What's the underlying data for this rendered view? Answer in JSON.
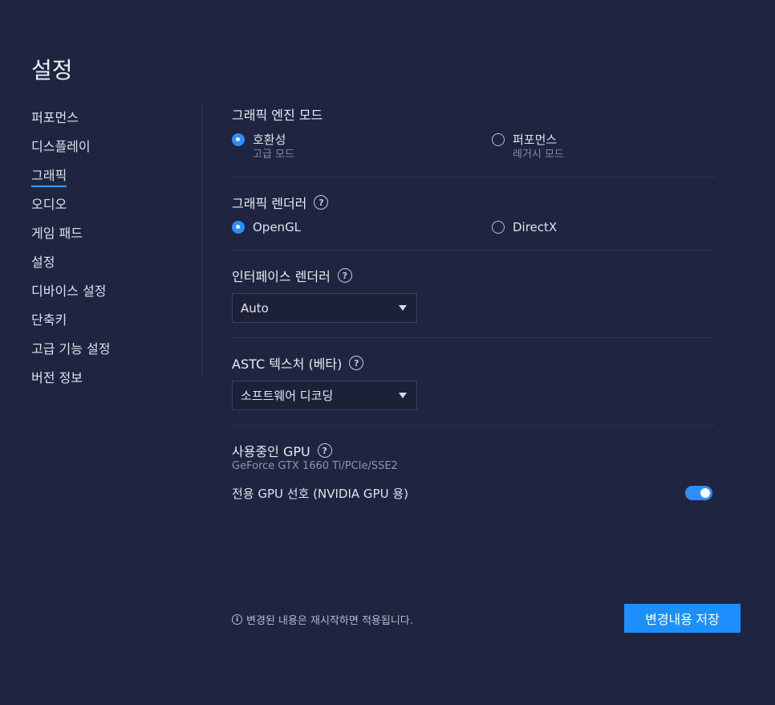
{
  "page_title": "설정",
  "sidebar": {
    "items": [
      {
        "label": "퍼포먼스"
      },
      {
        "label": "디스플레이"
      },
      {
        "label": "그래픽"
      },
      {
        "label": "오디오"
      },
      {
        "label": "게임 패드"
      },
      {
        "label": "설정"
      },
      {
        "label": "디바이스 설정"
      },
      {
        "label": "단축키"
      },
      {
        "label": "고급 기능 설정"
      },
      {
        "label": "버전 정보"
      }
    ],
    "active_label": "그래픽"
  },
  "engine_mode": {
    "title": "그래픽 엔진 모드",
    "options": [
      {
        "label": "호환성",
        "sub": "고급 모드",
        "selected": true
      },
      {
        "label": "퍼포먼스",
        "sub": "레거시 모드",
        "selected": false
      }
    ]
  },
  "renderer": {
    "title": "그래픽 렌더러",
    "help_icon": "question-circle-icon",
    "options": [
      {
        "label": "OpenGL",
        "selected": true
      },
      {
        "label": "DirectX",
        "selected": false
      }
    ]
  },
  "interface_renderer": {
    "title": "인터페이스 렌더러",
    "help_icon": "question-circle-icon",
    "selected": "Auto"
  },
  "astc": {
    "title": "ASTC 텍스처 (베타)",
    "help_icon": "question-circle-icon",
    "selected": "소프트웨어 디코딩"
  },
  "gpu": {
    "title": "사용중인 GPU",
    "help_icon": "question-circle-icon",
    "name": "GeForce GTX 1660 Ti/PCIe/SSE2",
    "preference_label": "전용 GPU 선호 (NVIDIA GPU 용)",
    "preference_on": true
  },
  "footer": {
    "notice_icon": "info-circle-icon",
    "notice": "변경된 내용은 재시작하면 적용됩니다.",
    "save_label": "변경내용 저장"
  },
  "colors": {
    "background": "#1f2440",
    "accent": "#1d8fff",
    "divider": "#2e3455"
  }
}
